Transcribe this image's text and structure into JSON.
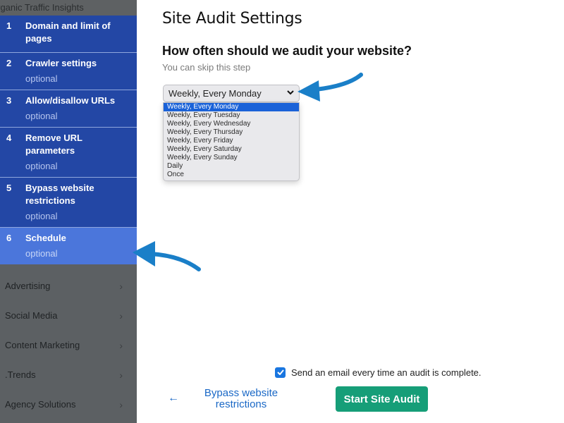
{
  "sidebar": {
    "top_partial_label": "Organic Traffic Insights",
    "steps": [
      {
        "num": "1",
        "title": "Domain and limit of pages",
        "sub": ""
      },
      {
        "num": "2",
        "title": "Crawler settings",
        "sub": "optional"
      },
      {
        "num": "3",
        "title": "Allow/disallow URLs",
        "sub": "optional"
      },
      {
        "num": "4",
        "title": "Remove URL parameters",
        "sub": "optional"
      },
      {
        "num": "5",
        "title": "Bypass website restrictions",
        "sub": "optional"
      },
      {
        "num": "6",
        "title": "Schedule",
        "sub": "optional",
        "active": true
      }
    ],
    "menu": [
      {
        "label": "Advertising",
        "icon": "chevron-right-icon"
      },
      {
        "label": "Social Media",
        "icon": "chevron-right-icon"
      },
      {
        "label": "Content Marketing",
        "icon": "chevron-right-icon"
      },
      {
        "label": ".Trends",
        "icon": "chevron-right-icon"
      },
      {
        "label": "Agency Solutions",
        "icon": "chevron-right-icon"
      }
    ]
  },
  "main": {
    "title": "Site Audit Settings",
    "question": "How often should we audit your website?",
    "hint": "You can skip this step",
    "schedule_select": {
      "value": "Weekly, Every Monday",
      "options": [
        "Weekly, Every Monday",
        "Weekly, Every Tuesday",
        "Weekly, Every Wednesday",
        "Weekly, Every Thursday",
        "Weekly, Every Friday",
        "Weekly, Every Saturday",
        "Weekly, Every Sunday",
        "Daily",
        "Once"
      ],
      "highlighted_index": 0
    },
    "email_checkbox": {
      "label": "Send an email every time an audit is complete.",
      "checked": true
    },
    "back_link": {
      "arrow": "←",
      "label_line1": "Bypass website",
      "label_line2": "restrictions"
    },
    "start_button": "Start Site Audit"
  },
  "colors": {
    "step_bg": "#2347a5",
    "step_active_bg": "#4b76db",
    "primary_button": "#169e78",
    "link": "#1a68c6",
    "annotation_arrow": "#1a7fc8"
  }
}
